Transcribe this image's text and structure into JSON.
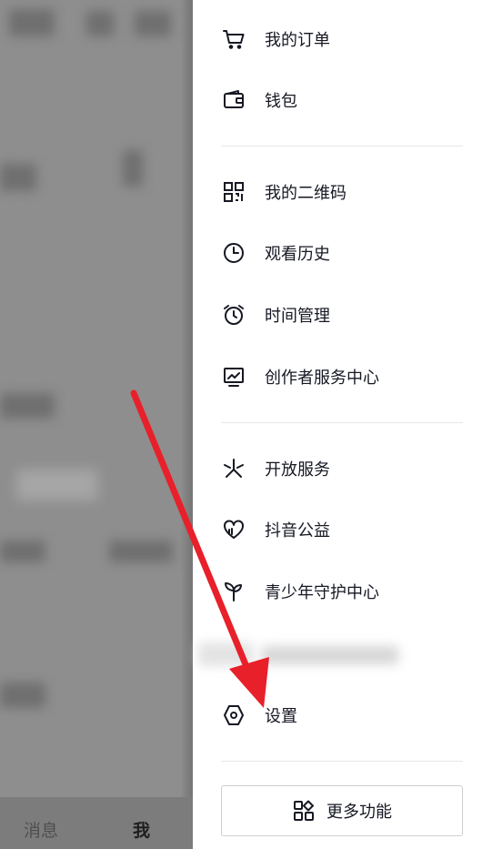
{
  "bottom_tabs": {
    "messages": "消息",
    "me": "我"
  },
  "drawer": {
    "group1": [
      {
        "label": "我的订单",
        "icon": "cart-icon"
      },
      {
        "label": "钱包",
        "icon": "wallet-icon"
      }
    ],
    "group2": [
      {
        "label": "我的二维码",
        "icon": "qr-code-icon"
      },
      {
        "label": "观看历史",
        "icon": "clock-icon"
      },
      {
        "label": "时间管理",
        "icon": "alarm-clock-icon"
      },
      {
        "label": "创作者服务中心",
        "icon": "creator-chart-icon"
      }
    ],
    "group3": [
      {
        "label": "开放服务",
        "icon": "open-service-icon"
      },
      {
        "label": "抖音公益",
        "icon": "heart-hands-icon"
      },
      {
        "label": "青少年守护中心",
        "icon": "sprout-icon"
      }
    ],
    "settings": {
      "label": "设置",
      "icon": "hexagon-settings-icon"
    },
    "more_button": {
      "label": "更多功能",
      "icon": "grid-apps-icon"
    }
  },
  "colors": {
    "text_primary": "#161823",
    "divider": "#e6e6e6",
    "annotation_arrow": "#e8202a"
  }
}
